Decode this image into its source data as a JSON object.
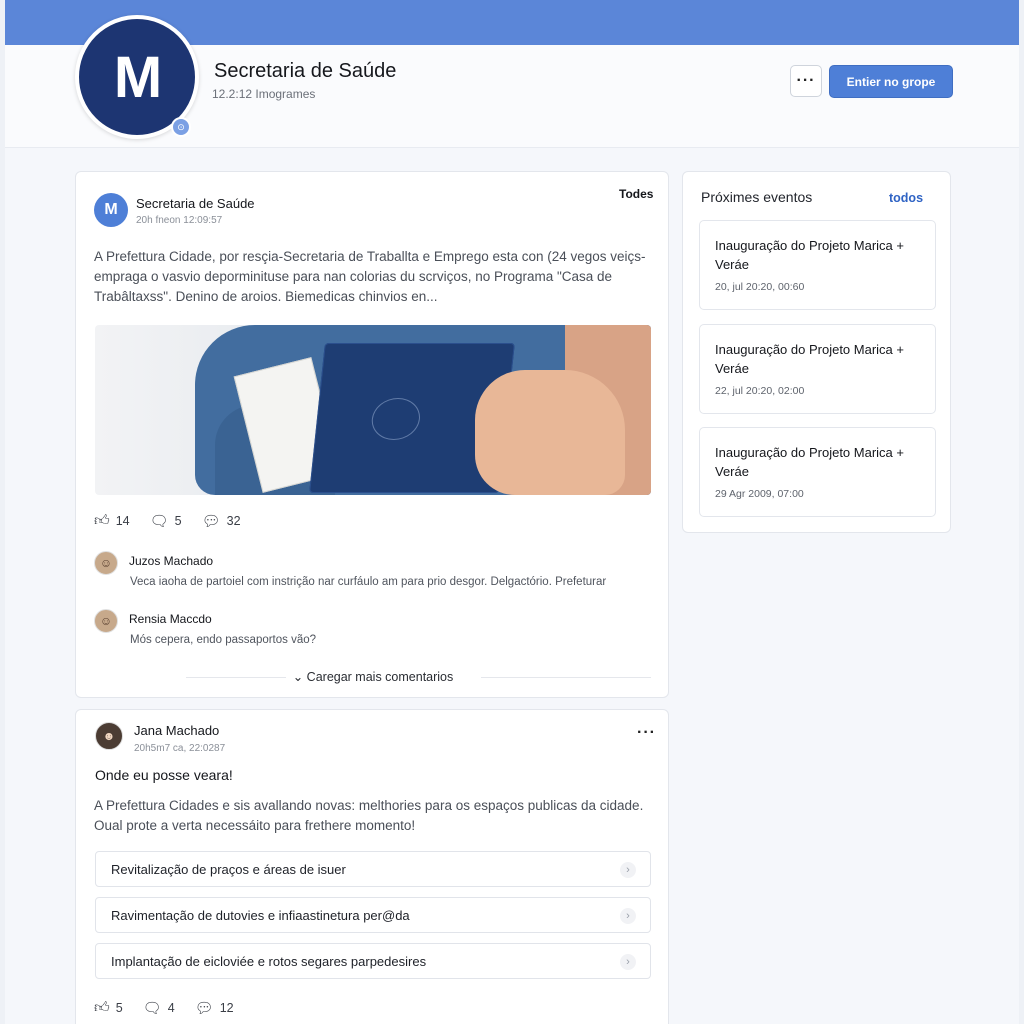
{
  "group": {
    "avatar_letter": "M",
    "title": "Secretaria de Saúde",
    "subtitle": "12.2:12 Imogrames",
    "more_label": "···",
    "join_label": "Entier no grope"
  },
  "colors": {
    "topbar": "#5b86d8",
    "accent": "#4e7fd7",
    "avatar_bg": "#1d3572"
  },
  "post1": {
    "author_initial": "M",
    "author": "Secretaria de Saúde",
    "time": "20h fneon 12:09:57",
    "filter": "Todes",
    "text": "A Prefettura Cidade, por resçia-Secretaria de Traballta e Emprego  esta con (24 vegos veiçs-empraga o vasvio deporminituse para nan colorias du scrviços, no Programa \"Casa de Trabâltaxss\". Denino de aroios. Biemedicas chinvios en...",
    "stats": {
      "likes": "14",
      "shares": "5",
      "comments": "32"
    },
    "comments": [
      {
        "name": "Juzos Machado",
        "text": "Veca iaoha de partoiel com instrição nar curfáulo am para prio desgor. Delgactório. Prefeturar"
      },
      {
        "name": "Rensia Maccdo",
        "text": "Mós cepera, endo passaportos vão?"
      }
    ],
    "load_more": "Caregar mais comentarios"
  },
  "post2": {
    "author": "Jana Machado",
    "time": "20h5m7 ca, 22:0287",
    "menu_label": "···",
    "title": "Onde eu posse veara!",
    "text": "A Prefettura Cidades e sis avallando novas: melthories para os espaços publicas da cidade. Oual prote a verta necessáito para frethere momento!",
    "options": [
      "Revitalização de praços e áreas de isuer",
      "Ravimentação de dutovies e infiaastinetura per@da",
      "Implantação de eicloviée e rotos segares parpedesires"
    ],
    "stats": {
      "likes": "5",
      "shares": "4",
      "comments": "12"
    }
  },
  "sidebar": {
    "title": "Próximes eventos",
    "link": "todos",
    "events": [
      {
        "title": "Inauguração do Projeto Marica + Veráe",
        "date": "20, jul 20:20, 00:60"
      },
      {
        "title": "Inauguração do Projeto Marica + Veráe",
        "date": "22, jul 20:20, 02:00"
      },
      {
        "title": "Inauguração do Projeto Marica + Veráe",
        "date": "29 Agr 2009, 07:00"
      }
    ]
  }
}
